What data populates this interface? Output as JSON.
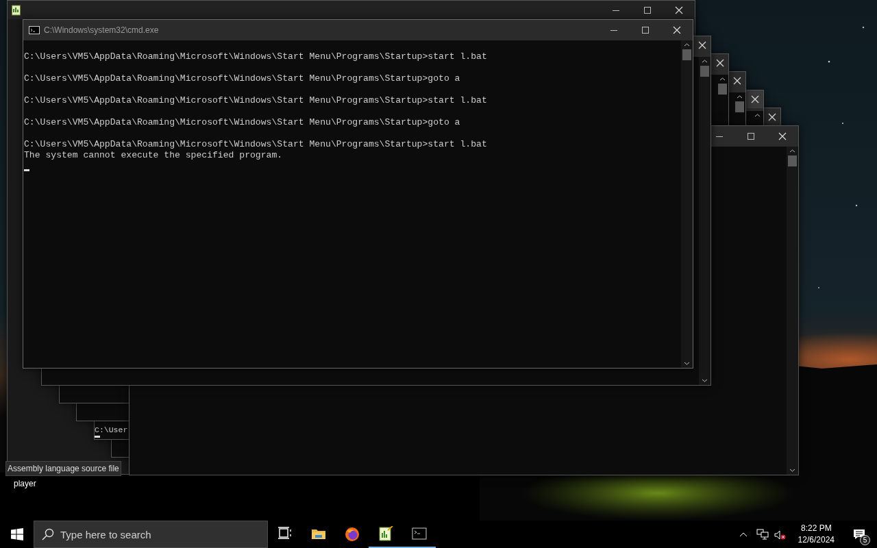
{
  "main_window": {
    "title": "C:\\Windows\\system32\\cmd.exe",
    "blocks": [
      [
        "C:\\Users\\VM5\\AppData\\Roaming\\Microsoft\\Windows\\Start Menu\\Programs\\Startup>start l.bat"
      ],
      [
        "C:\\Users\\VM5\\AppData\\Roaming\\Microsoft\\Windows\\Start Menu\\Programs\\Startup>goto a"
      ],
      [
        "C:\\Users\\VM5\\AppData\\Roaming\\Microsoft\\Windows\\Start Menu\\Programs\\Startup>start l.bat"
      ],
      [
        "C:\\Users\\VM5\\AppData\\Roaming\\Microsoft\\Windows\\Start Menu\\Programs\\Startup>goto a"
      ],
      [
        "C:\\Users\\VM5\\AppData\\Roaming\\Microsoft\\Windows\\Start Menu\\Programs\\Startup>start l.bat",
        "The system cannot execute the specified program."
      ]
    ]
  },
  "background_windows": [
    {
      "kind": "close"
    },
    {
      "kind": "close"
    },
    {
      "kind": "close"
    },
    {
      "kind": "close",
      "lines": [
        "C:\\User"
      ]
    },
    {
      "kind": "close"
    },
    {
      "kind": "full"
    }
  ],
  "tooltip": "Assembly language source file",
  "desktop_icon_label": "player",
  "taskbar": {
    "search_placeholder": "Type here to search",
    "apps": [
      {
        "kind": "task-view"
      },
      {
        "kind": "explorer",
        "running": false
      },
      {
        "kind": "firefox",
        "running": false
      },
      {
        "kind": "notepad",
        "running": true
      },
      {
        "kind": "terminal",
        "running": true
      }
    ],
    "tray": {
      "volume_muted": true,
      "time": "8:22 PM",
      "date": "12/6/2024",
      "notifications": "5"
    }
  }
}
